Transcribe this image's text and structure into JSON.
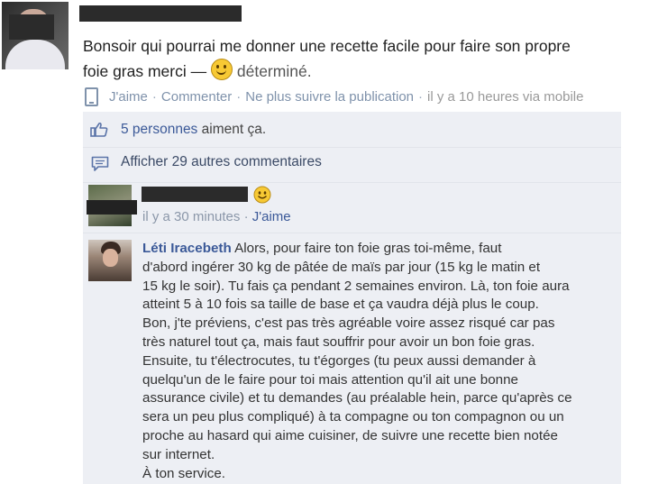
{
  "post": {
    "text_line1": "Bonsoir qui pourrai me donner une recette facile pour faire son propre",
    "text_line2": "foie gras merci —",
    "feeling": "déterminé."
  },
  "actions": {
    "like": "J'aime",
    "comment": "Commenter",
    "unfollow": "Ne plus suivre la publication",
    "timestamp": "il y a 10 heures via mobile",
    "separator": "·"
  },
  "likes": {
    "count_text": "5 personnes",
    "suffix": "aiment ça."
  },
  "more_comments": {
    "label": "Afficher 29 autres commentaires"
  },
  "comment1": {
    "time": "il y a 30 minutes",
    "like": "J'aime",
    "separator": "·"
  },
  "comment2": {
    "author": "Léti Iracebeth",
    "lines": [
      "Alors, pour faire ton foie gras toi-même, faut",
      "d'abord ingérer 30 kg de pâtée de maïs par jour (15 kg le matin et",
      "15 kg le soir). Tu fais ça pendant 2 semaines environ. Là, ton foie aura",
      "atteint 5 à 10 fois sa taille de base et ça vaudra déjà plus le coup.",
      "Bon, j'te préviens, c'est pas très agréable voire assez risqué car pas",
      "très naturel tout ça, mais faut souffrir pour avoir un bon foie gras.",
      "Ensuite, tu t'électrocutes, tu t'égorges (tu peux aussi demander à",
      "quelqu'un de le faire pour toi mais attention qu'il ait une bonne",
      "assurance civile) et tu demandes (au préalable hein, parce qu'après ce",
      "sera un peu plus compliqué) à ta compagne ou ton compagnon ou un",
      "proche au hasard qui aime cuisiner, de suivre une recette bien notée",
      "sur internet.",
      "À ton service."
    ]
  },
  "icons": {
    "mobile": "phone-icon",
    "like": "thumbs-up-icon",
    "comments": "speech-bubble-icon",
    "emoji": "smiley-icon"
  },
  "colors": {
    "link": "#3b5998",
    "action_text": "#7f92ab",
    "panel_bg": "#edeff4",
    "censor": "#2b2b2b"
  }
}
